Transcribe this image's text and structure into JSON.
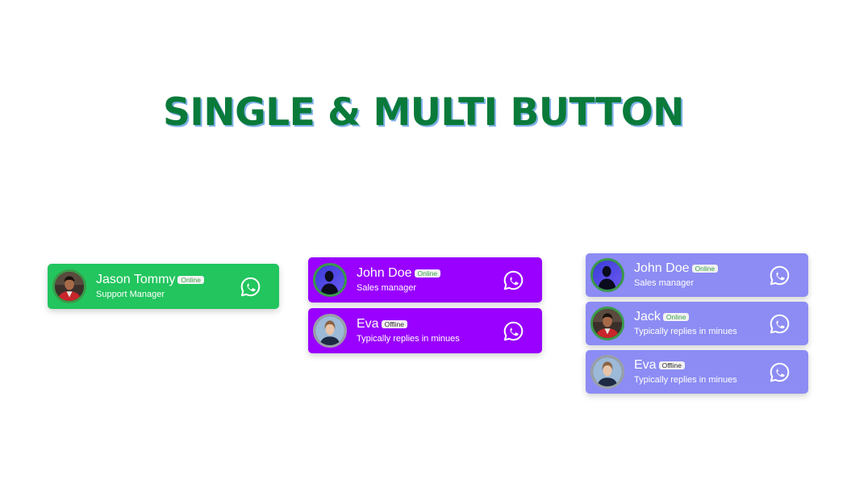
{
  "page": {
    "title": "SINGLE & MULTI BUTTON"
  },
  "colors": {
    "title": "#0a7a3a",
    "single_card": "#22c55e",
    "multi_card": "#9900ff",
    "multi_card_light": "#8c8cf4",
    "online_text": "#3aa34a"
  },
  "single": {
    "agents": [
      {
        "name": "Jason Tommy",
        "status": "Online",
        "role": "Support Manager",
        "avatar": "man-red-jacket-avatar",
        "icon": "whatsapp-icon"
      }
    ]
  },
  "multi_two": {
    "agents": [
      {
        "name": "John Doe",
        "status": "Online",
        "role": "Sales manager",
        "avatar": "silhouette-avatar",
        "icon": "whatsapp-icon"
      },
      {
        "name": "Eva",
        "status": "Offline",
        "role": "Typically replies in minues",
        "avatar": "woman-avatar",
        "icon": "whatsapp-icon"
      }
    ]
  },
  "multi_three": {
    "agents": [
      {
        "name": "John Doe",
        "status": "Online",
        "role": "Sales manager",
        "avatar": "silhouette-avatar",
        "icon": "whatsapp-icon"
      },
      {
        "name": "Jack",
        "status": "Online",
        "role": "Typically replies in minues",
        "avatar": "man-red-jacket-avatar",
        "icon": "whatsapp-icon"
      },
      {
        "name": "Eva",
        "status": "Offline",
        "role": "Typically replies in minues",
        "avatar": "woman-avatar",
        "icon": "whatsapp-icon"
      }
    ]
  }
}
